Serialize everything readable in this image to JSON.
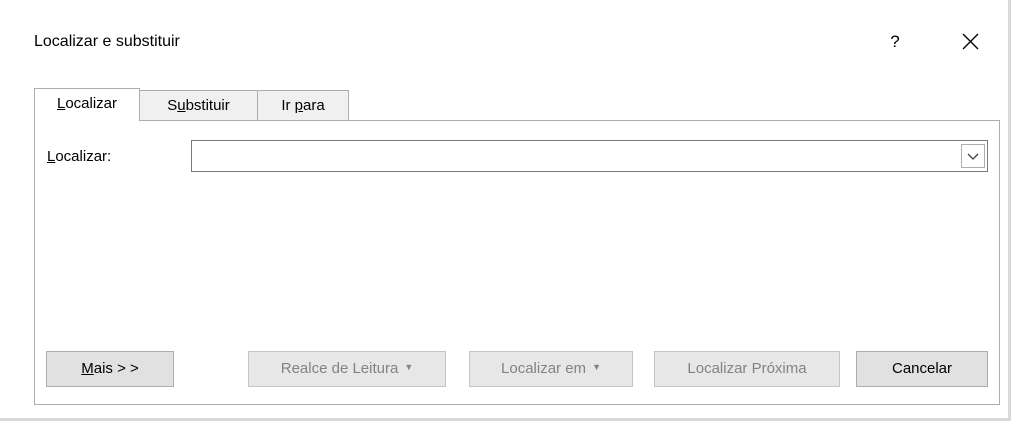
{
  "dialog": {
    "title": "Localizar e substituir",
    "help_label": "?",
    "close_icon": "close-icon"
  },
  "tabs": [
    {
      "mnemonic": "L",
      "rest": "ocalizar",
      "active": true
    },
    {
      "prefix": "S",
      "mnemonic": "u",
      "rest": "bstituir",
      "active": false
    },
    {
      "prefix": "Ir ",
      "mnemonic": "p",
      "rest": "ara",
      "active": false
    }
  ],
  "find": {
    "label_mnemonic": "L",
    "label_rest": "ocalizar:",
    "value": "",
    "dropdown_icon": "chevron-down-icon"
  },
  "buttons": {
    "more": {
      "mnemonic": "M",
      "rest": "ais > >"
    },
    "reading_highlight": {
      "label": "Realce de Leitura",
      "enabled": false
    },
    "find_in": {
      "label": "Localizar em",
      "enabled": false
    },
    "find_next": {
      "label": "Localizar Próxima",
      "enabled": false
    },
    "cancel": {
      "label": "Cancelar",
      "enabled": true
    }
  }
}
